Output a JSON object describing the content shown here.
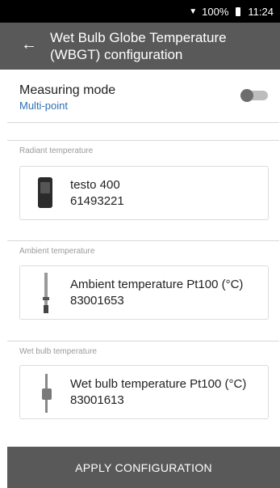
{
  "status_bar": {
    "battery_percent": "100%",
    "time": "11:24"
  },
  "app_bar": {
    "title": "Wet Bulb Globe Temperature (WBGT) configuration"
  },
  "measuring_mode": {
    "label": "Measuring mode",
    "value": "Multi-point",
    "toggle_on": false
  },
  "sections": [
    {
      "label": "Radiant temperature",
      "device_name": "testo 400",
      "serial": "61493221",
      "icon": "meter-device-icon"
    },
    {
      "label": "Ambient temperature",
      "device_name": "Ambient temperature Pt100 (°C)",
      "serial": "83001653",
      "icon": "temperature-probe-icon"
    },
    {
      "label": "Wet bulb temperature",
      "device_name": "Wet bulb temperature Pt100 (°C)",
      "serial": "83001613",
      "icon": "wet-bulb-probe-icon"
    }
  ],
  "apply_button": {
    "label": "APPLY CONFIGURATION"
  },
  "colors": {
    "app_bar": "#595959",
    "accent_text": "#2f6fb3"
  }
}
